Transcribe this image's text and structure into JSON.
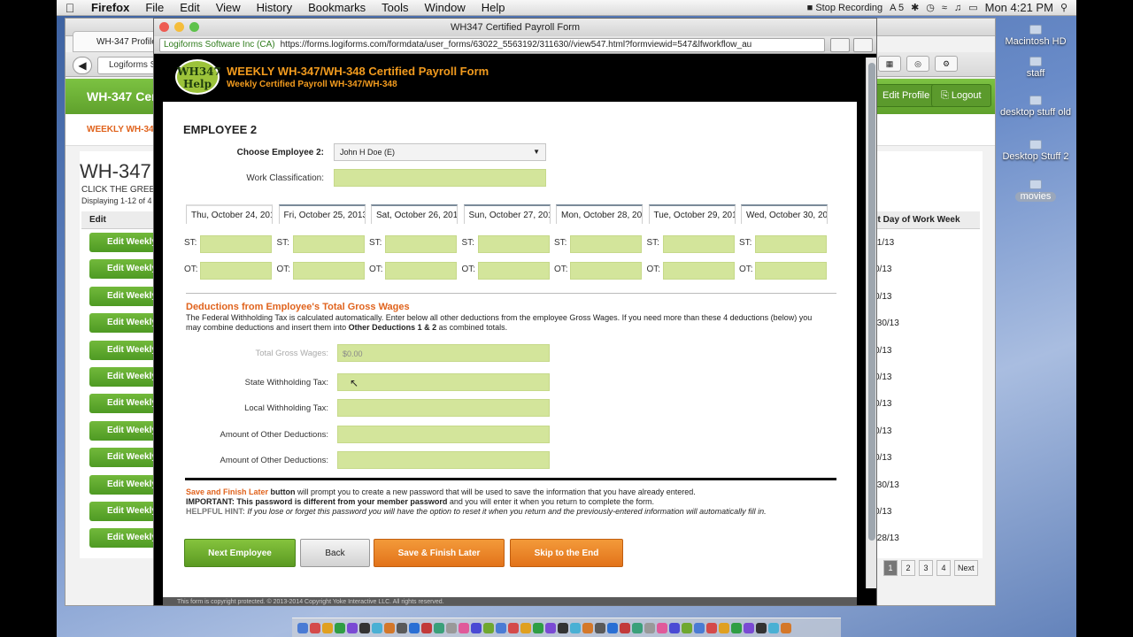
{
  "menubar": {
    "apple": "",
    "app": "Firefox",
    "items": [
      "File",
      "Edit",
      "View",
      "History",
      "Bookmarks",
      "Tools",
      "Window",
      "Help"
    ],
    "recording": "Stop Recording",
    "adobe": "5",
    "clock": "Mon 4:21 PM"
  },
  "desktop": {
    "items": [
      {
        "label": "Macintosh HD"
      },
      {
        "label": "staff"
      },
      {
        "label": "desktop stuff old"
      },
      {
        "label": "Desktop Stuff 2"
      },
      {
        "label": "movies"
      }
    ]
  },
  "back_window": {
    "tab": "WH-347 Profile",
    "url": "Logiforms S",
    "header_title": "WH-347 Cert",
    "edit_profile": "Edit Profile",
    "logout": "Logout",
    "sub_title": "WEEKLY WH-34",
    "heading": "WH-347",
    "click_text": "CLICK THE GREEN",
    "displaying": "Displaying 1-12 of 4",
    "col_edit": "Edit",
    "col_last": "st Day of Work Week",
    "row_button": "Edit Weekly",
    "dates": [
      "/1/13",
      "0/13",
      "0/13",
      "/30/13",
      "0/13",
      "0/13",
      "0/13",
      "0/13",
      "0/13",
      "/30/13",
      "0/13",
      "/28/13"
    ],
    "pager": [
      "1",
      "2",
      "3",
      "4",
      "Next"
    ]
  },
  "front_window": {
    "title": "WH347 Certified Payroll Form",
    "site_badge": "Logiforms Software Inc (CA)",
    "url": "https://forms.logiforms.com/formdata/user_forms/63022_5563192/311630//view547.html?formviewid=547&lfworkflow_au",
    "logo": "WH347 Help",
    "header_title": "WEEKLY WH-347/WH-348 Certified Payroll Form",
    "header_sub": "Weekly Certified Payroll WH-347/WH-348",
    "footer": "This form is copyright protected. © 2013-2014 Copyright Yoke Interactive LLC. All rights reserved."
  },
  "form": {
    "employee_heading": "EMPLOYEE 2",
    "choose_label": "Choose Employee 2:",
    "employee_value": "John H Doe (E)",
    "classification_label": "Work Classification:",
    "days": [
      "Thu, October 24, 201",
      "Fri, October 25, 2013",
      "Sat, October 26, 201",
      "Sun, October 27, 201",
      "Mon, October 28, 20",
      "Tue, October 29, 201",
      "Wed, October 30, 20"
    ],
    "st_label": "ST:",
    "ot_label": "OT:",
    "deductions_heading": "Deductions from Employee's Total Gross Wages",
    "deductions_text_1": "The Federal Withholding Tax is calculated automatically. Enter below all other deductions from the employee Gross Wages. If you need more than these 4 deductions (below) you may combine deductions and insert them into ",
    "deductions_bold": "Other Deductions 1 & 2",
    "deductions_text_2": " as combined totals.",
    "gross_label": "Total Gross Wages:",
    "gross_value": "$0.00",
    "state_label": "State Withholding Tax:",
    "local_label": "Local Withholding Tax:",
    "other1_label": "Amount of Other Deductions:",
    "other2_label": "Amount of Other Deductions:",
    "note1_bold": "Save and Finish Later",
    "note1_btn": " button",
    "note1_text": " will prompt you to create a new password that will be used to save the information that you have already entered.",
    "note2_bold": "IMPORTANT: This password is different from your member password",
    "note2_text": " and you will enter it when you return to complete the form.",
    "note3_bold": "HELPFUL HINT:",
    "note3_text": " If you lose or forget this password you will have the option to reset it when you return and the previously-entered information will automatically fill in.",
    "btn_next": "Next Employee",
    "btn_back": "Back",
    "btn_save": "Save & Finish Later",
    "btn_skip": "Skip to the End"
  },
  "colors": {
    "accent_green": "#7cc242",
    "field_green": "#d3e59b",
    "accent_orange": "#e0631d"
  }
}
